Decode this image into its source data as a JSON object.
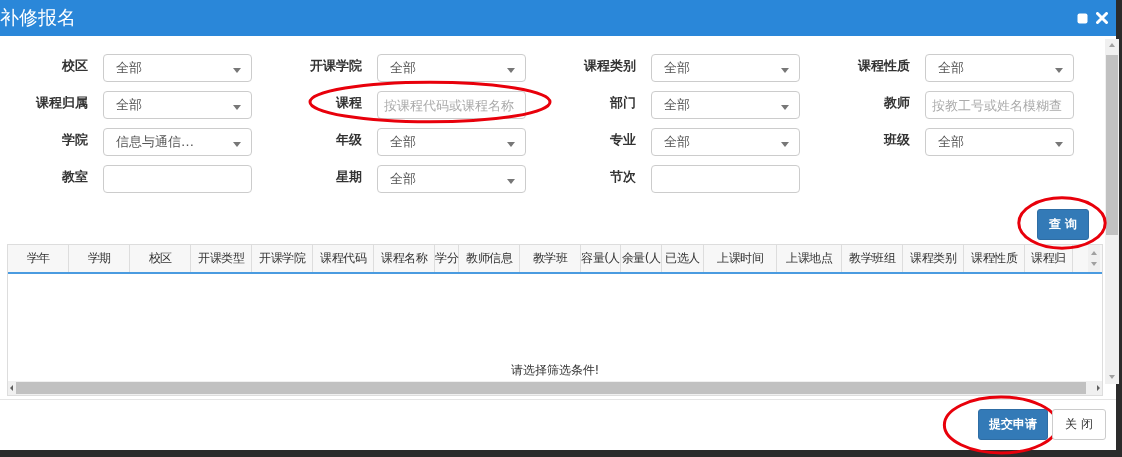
{
  "window": {
    "title": "补修报名"
  },
  "filters": [
    {
      "label": "校区",
      "kind": "select",
      "value": "全部",
      "highlighted": false
    },
    {
      "label": "开课学院",
      "kind": "select",
      "value": "全部",
      "highlighted": false
    },
    {
      "label": "课程类别",
      "kind": "select",
      "value": "全部",
      "highlighted": false
    },
    {
      "label": "课程性质",
      "kind": "select",
      "value": "全部",
      "highlighted": false
    },
    {
      "label": "课程归属",
      "kind": "select",
      "value": "全部",
      "highlighted": false
    },
    {
      "label": "课程",
      "kind": "text",
      "placeholder": "按课程代码或课程名称",
      "highlighted": true
    },
    {
      "label": "部门",
      "kind": "select",
      "value": "全部",
      "highlighted": false
    },
    {
      "label": "教师",
      "kind": "text",
      "placeholder": "按教工号或姓名模糊查",
      "highlighted": false
    },
    {
      "label": "学院",
      "kind": "select",
      "value": "信息与通信…",
      "highlighted": false
    },
    {
      "label": "年级",
      "kind": "select",
      "value": "全部",
      "highlighted": false
    },
    {
      "label": "专业",
      "kind": "select",
      "value": "全部",
      "highlighted": false
    },
    {
      "label": "班级",
      "kind": "select",
      "value": "全部",
      "highlighted": false
    },
    {
      "label": "教室",
      "kind": "text",
      "highlighted": false
    },
    {
      "label": "星期",
      "kind": "select",
      "value": "全部",
      "highlighted": false
    },
    {
      "label": "节次",
      "kind": "text",
      "highlighted": false
    }
  ],
  "query_button": {
    "label": "查 询",
    "highlighted": true
  },
  "table": {
    "columns": [
      "学年",
      "学期",
      "校区",
      "开课类型",
      "开课学院",
      "课程代码",
      "课程名称",
      "学分",
      "教师信息",
      "教学班",
      "容量(人",
      "余量(人",
      "已选人",
      "上课时间",
      "上课地点",
      "教学班组",
      "课程类别",
      "课程性质",
      "课程归"
    ],
    "empty_message": "请选择筛选条件!"
  },
  "footer_buttons": [
    {
      "label": "提交申请",
      "kind": "primary",
      "highlighted": true
    },
    {
      "label": "关 闭",
      "kind": "default",
      "highlighted": false
    }
  ]
}
